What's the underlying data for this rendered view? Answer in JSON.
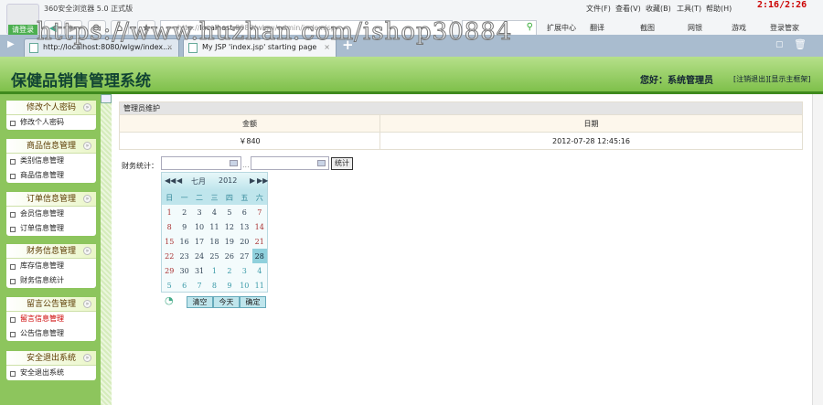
{
  "browser": {
    "name": "360安全浏览器 5.0 正式版",
    "login": "请登录",
    "address_host": "localhost",
    "address_rest": ":8080/wlgw/admin/index.jsp",
    "address_prefix": "http://",
    "menus": [
      "文件(F)",
      "查看(V)",
      "收藏(B)",
      "工具(T)",
      "帮助(H)"
    ],
    "clock": "2:16/2:26",
    "tools": [
      "扩展中心",
      "翻译",
      "截图",
      "网银",
      "游戏",
      "登录管家"
    ],
    "tabs": [
      {
        "label": "http://localhost:8080/wlgw/index....",
        "active": false
      },
      {
        "label": "My JSP 'index.jsp' starting page",
        "active": true
      }
    ],
    "watermark": "https://www.huzhan.com/ishop30884"
  },
  "header": {
    "title": "保健品销售管理系统",
    "greeting": "您好：系统管理员",
    "logout": "[注销退出]",
    "show_frame": "[显示主框架]"
  },
  "sidebar": [
    {
      "title": "修改个人密码",
      "items": [
        "修改个人密码"
      ]
    },
    {
      "title": "商品信息管理",
      "items": [
        "类别信息管理",
        "商品信息管理"
      ]
    },
    {
      "title": "订单信息管理",
      "items": [
        "会员信息管理",
        "订单信息管理"
      ]
    },
    {
      "title": "财务信息管理",
      "items": [
        "库存信息管理",
        "财务信息统计"
      ]
    },
    {
      "title": "留言公告管理",
      "items": [
        "留言信息管理",
        "公告信息管理"
      ]
    },
    {
      "title": "安全退出系统",
      "items": [
        "安全退出系统"
      ]
    }
  ],
  "table": {
    "caption": "管理员维护",
    "columns": [
      "金额",
      "日期"
    ],
    "rows": [
      [
        "￥840",
        "2012-07-28 12:45:16"
      ]
    ]
  },
  "finance": {
    "label": "财务统计：",
    "from": "",
    "to": "",
    "separator": "...",
    "button": "统计"
  },
  "calendar": {
    "month": "七月",
    "year": "2012",
    "weekdays": [
      "日",
      "一",
      "二",
      "三",
      "四",
      "五",
      "六"
    ],
    "weeks": [
      [
        "1",
        "2",
        "3",
        "4",
        "5",
        "6",
        "7"
      ],
      [
        "8",
        "9",
        "10",
        "11",
        "12",
        "13",
        "14"
      ],
      [
        "15",
        "16",
        "17",
        "18",
        "19",
        "20",
        "21"
      ],
      [
        "22",
        "23",
        "24",
        "25",
        "26",
        "27",
        "28"
      ],
      [
        "29",
        "30",
        "31",
        "1",
        "2",
        "3",
        "4"
      ],
      [
        "5",
        "6",
        "7",
        "8",
        "9",
        "10",
        "11"
      ]
    ],
    "selected": "28",
    "clear": "清空",
    "today": "今天",
    "ok": "确定"
  }
}
